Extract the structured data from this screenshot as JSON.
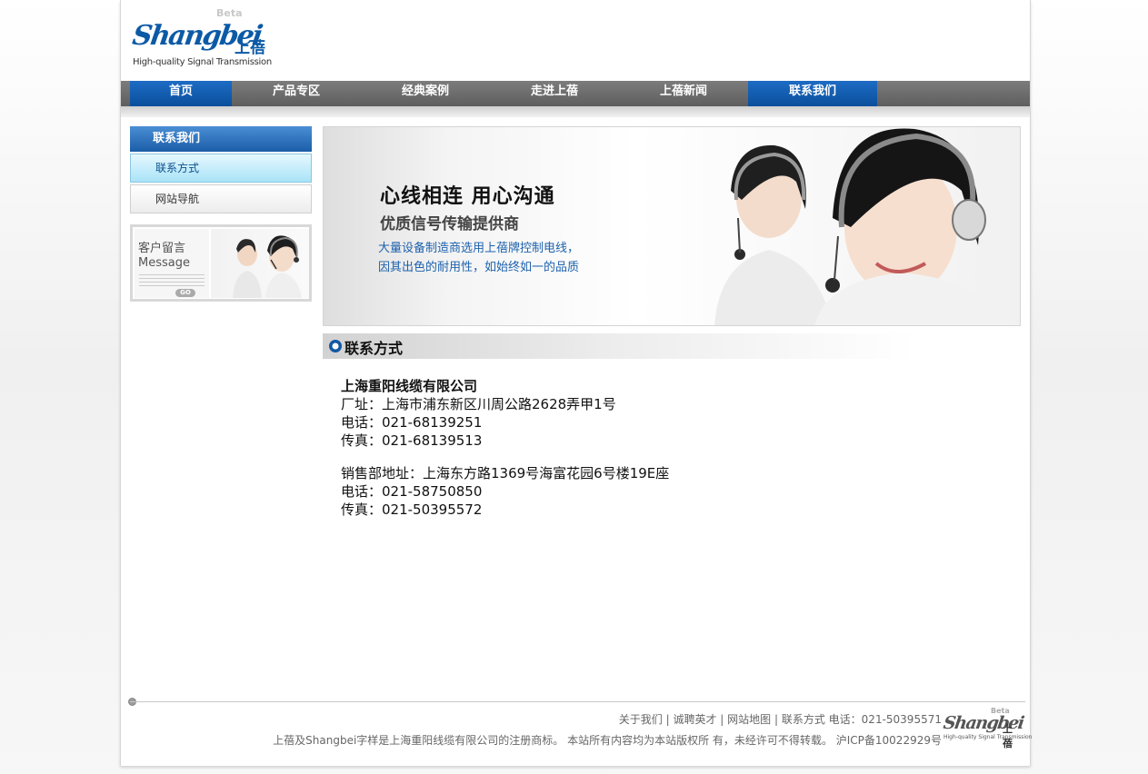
{
  "logo": {
    "beta": "Beta",
    "word": "Shangbei",
    "cn": "上蓓",
    "tagline": "High-quality Signal Transmission"
  },
  "nav": {
    "items": [
      {
        "label": "首页"
      },
      {
        "label": "产品专区"
      },
      {
        "label": "经典案例"
      },
      {
        "label": "走进上蓓"
      },
      {
        "label": "上蓓新闻"
      },
      {
        "label": "联系我们"
      }
    ],
    "active_items": [
      "首页",
      "联系我们"
    ]
  },
  "sidebar": {
    "title": "联系我们",
    "items": [
      {
        "label": "联系方式",
        "active": true
      },
      {
        "label": "网站导航",
        "active": false
      }
    ],
    "message": {
      "cn": "客户留言",
      "en": "Message",
      "go": "GO"
    }
  },
  "banner": {
    "headline": "心线相连 用心沟通",
    "subhead": "优质信号传输提供商",
    "line1": "大量设备制造商选用上蓓牌控制电线，",
    "line2": "因其出色的耐用性，如始终如一的品质"
  },
  "section": {
    "title": "联系方式"
  },
  "contact": {
    "company": "上海重阳线缆有限公司",
    "factory_address": "厂址：上海市浦东新区川周公路2628弄甲1号",
    "phone": "电话：021-68139251",
    "fax": "传真：021-68139513",
    "sales_address": "销售部地址：上海东方路1369号海富花园6号楼19E座",
    "sales_phone": "电话：021-58750850",
    "sales_fax": "传真：021-50395572"
  },
  "footer": {
    "links": [
      "关于我们",
      "诚聘英才",
      "网站地图",
      "联系方式"
    ],
    "separator": " | ",
    "phone": "电话：021-50395571",
    "copyright": "上蓓及Shangbei字样是上海重阳线缆有限公司的注册商标。 本站所有内容均为本站版权所 有，未经许可不得转载。 沪ICP备10022929号"
  },
  "colors": {
    "brand_blue": "#0c5aa6",
    "nav_active": "#1560b6",
    "nav_bg": "#6e6e6e",
    "link_blue": "#1d62ad"
  }
}
